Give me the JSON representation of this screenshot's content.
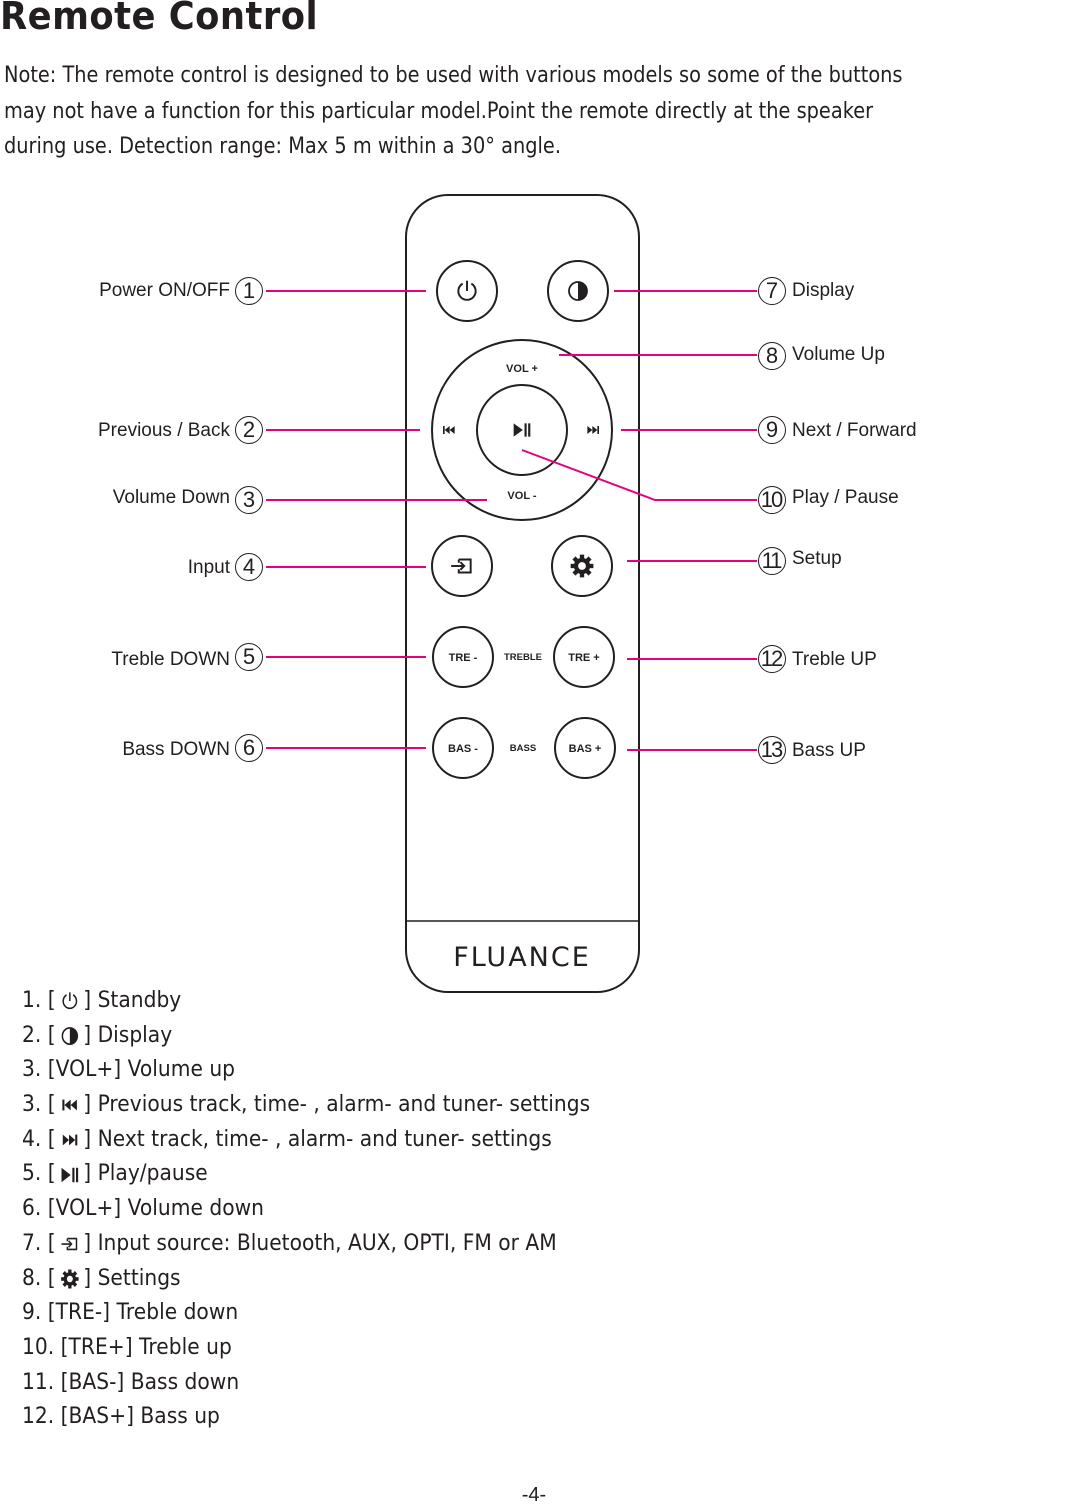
{
  "title": "Remote Control",
  "note": {
    "lines": [
      "Note: The remote control is designed to be used with various models so some of the buttons",
      "may not have a function for this particular model.Point the remote directly at the speaker",
      "during use. Detection range: Max 5 m within a 30°   angle."
    ]
  },
  "colors": {
    "leader_line": "#e6007e",
    "ink": "#231f20"
  },
  "remote": {
    "brand": "FLUANCE",
    "buttons": {
      "power": {
        "icon": "power-icon"
      },
      "display": {
        "icon": "half-circle-icon"
      },
      "vol_up": "VOL  +",
      "vol_down": "VOL  -",
      "previous": {
        "icon": "skip-previous-icon"
      },
      "next": {
        "icon": "skip-next-icon"
      },
      "play_pause": {
        "icon": "play-pause-icon"
      },
      "input": {
        "icon": "input-source-icon"
      },
      "setup": {
        "icon": "gear-icon"
      },
      "treble_down": "TRE -",
      "treble_caption": "TREBLE",
      "treble_up": "TRE +",
      "bass_down": "BAS -",
      "bass_caption": "BASS",
      "bass_up": "BAS +"
    }
  },
  "callouts": {
    "left": [
      {
        "num": "1",
        "label": "Power ON/OFF"
      },
      {
        "num": "2",
        "label": "Previous / Back"
      },
      {
        "num": "3",
        "label": "Volume Down"
      },
      {
        "num": "4",
        "label": "Input"
      },
      {
        "num": "5",
        "label": "Treble DOWN"
      },
      {
        "num": "6",
        "label": "Bass DOWN"
      }
    ],
    "right": [
      {
        "num": "7",
        "label": "Display"
      },
      {
        "num": "8",
        "label": "Volume Up"
      },
      {
        "num": "9",
        "label": "Next / Forward"
      },
      {
        "num": "10",
        "label": "Play / Pause"
      },
      {
        "num": "11",
        "label": "Setup"
      },
      {
        "num": "12",
        "label": "Treble UP"
      },
      {
        "num": "13",
        "label": "Bass UP"
      }
    ]
  },
  "legend": [
    {
      "prefix": "1. [",
      "icon": "power-icon",
      "key": "",
      "suffix": "] Standby"
    },
    {
      "prefix": "2. [",
      "icon": "half-circle-icon",
      "key": "",
      "suffix": "] Display"
    },
    {
      "prefix": "3. [",
      "icon": "",
      "key": "VOL+",
      "suffix": "] Volume up"
    },
    {
      "prefix": "3. [",
      "icon": "skip-previous-icon",
      "key": "",
      "suffix": "] Previous track, time- , alarm- and tuner- settings"
    },
    {
      "prefix": "4. [",
      "icon": "skip-next-icon",
      "key": "",
      "suffix": "] Next track, time- , alarm- and tuner- settings"
    },
    {
      "prefix": "5. [",
      "icon": "play-pause-icon",
      "key": "",
      "suffix": "] Play/pause"
    },
    {
      "prefix": "6. [",
      "icon": "",
      "key": "VOL+",
      "suffix": "] Volume down"
    },
    {
      "prefix": "7. [",
      "icon": "input-source-icon",
      "key": "",
      "suffix": "] Input source: Bluetooth, AUX, OPTI, FM or AM"
    },
    {
      "prefix": "8. [",
      "icon": "gear-icon",
      "key": "",
      "suffix": "] Settings"
    },
    {
      "prefix": "9. [",
      "icon": "",
      "key": "TRE-",
      "suffix": "] Treble down"
    },
    {
      "prefix": "10. [",
      "icon": "",
      "key": "TRE+",
      "suffix": "] Treble up"
    },
    {
      "prefix": "11. [",
      "icon": "",
      "key": "BAS-",
      "suffix": "] Bass down"
    },
    {
      "prefix": "12. [",
      "icon": "",
      "key": "BAS+",
      "suffix": "] Bass up"
    }
  ],
  "page_number": "-4-"
}
